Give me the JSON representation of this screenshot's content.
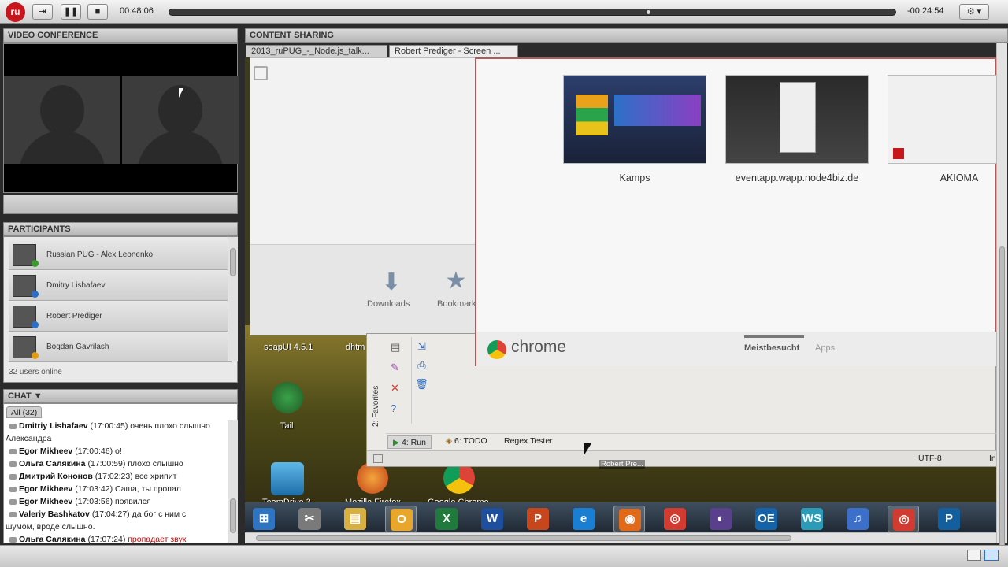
{
  "player": {
    "logo_text": "ru",
    "elapsed": "00:48:06",
    "remaining": "-00:24:54",
    "progress": 0.66,
    "gear_label": "⚙ ▾"
  },
  "video_panel": {
    "title": "VIDEO CONFERENCE"
  },
  "participants_panel": {
    "title": "PARTICIPANTS",
    "items": [
      {
        "name": "Russian PUG - Alex Leonenko",
        "status_color": "#3c9a2e"
      },
      {
        "name": "Dmitry Lishafaev",
        "status_color": "#2a6fc9"
      },
      {
        "name": "Robert Prediger",
        "status_color": "#2a6fc9"
      },
      {
        "name": "Bogdan Gavrilash",
        "status_color": "#e39b12"
      }
    ],
    "online_count": "32 users online"
  },
  "chat_panel": {
    "title": "CHAT ▼",
    "tab_all": "All (32)",
    "messages": [
      {
        "author": "Dmitriy Lishafaev",
        "time": "(17:00:45)",
        "text": "очень плохо слышно"
      },
      {
        "author": "",
        "time": "",
        "text": "Александра"
      },
      {
        "author": "Egor Mikheev",
        "time": "(17:00:46)",
        "text": "о!"
      },
      {
        "author": "Ольга Салякина",
        "time": "(17:00:59)",
        "text": "плохо слышно"
      },
      {
        "author": "Дмитрий Кононов",
        "time": "(17:02:23)",
        "text": "все хрипит"
      },
      {
        "author": "Egor Mikheev",
        "time": "(17:03:42)",
        "text": "Саша, ты пропал"
      },
      {
        "author": "Egor Mikheev",
        "time": "(17:03:56)",
        "text": "появился"
      },
      {
        "author": "Valeriy Bashkatov",
        "time": "(17:04:27)",
        "text": "да бог с ним с"
      },
      {
        "author": "",
        "time": "",
        "text": "шумом, вроде слышно."
      },
      {
        "author": "Ольга Салякина",
        "time": "(17:07:24)",
        "text": "пропадает звук"
      }
    ]
  },
  "content_panel": {
    "title": "CONTENT SHARING",
    "tabs": [
      {
        "label": "2013_ruPUG_-_Node.js_talk..."
      },
      {
        "label": "Robert Prediger - Screen ..."
      }
    ]
  },
  "shared_screen": {
    "chrome_left": {
      "downloads_label": "Downloads",
      "bookmarks_label": "Bookmarks"
    },
    "chrome_right": {
      "thumbnails": [
        {
          "label": "Kamps"
        },
        {
          "label": "eventapp.wapp.node4biz.de"
        },
        {
          "label": "AKIOMA"
        }
      ],
      "brand": "chrome",
      "tab_most_visited": "Meistbesucht",
      "tab_apps": "Apps"
    },
    "desktop_icons": [
      {
        "label": "soapUI 4.5.1"
      },
      {
        "label": "dhtm"
      },
      {
        "label": "Tail"
      },
      {
        "label": "TeamDrive 3"
      },
      {
        "label": "Mozilla Firefox"
      },
      {
        "label": "Google Chrome"
      }
    ],
    "ide": {
      "favorites_label": "2: Favorites",
      "run_label": "4: Run",
      "todo_label": "6: TODO",
      "regex_label": "Regex Tester",
      "encoding": "UTF-8",
      "insert": "In"
    },
    "cursor_label": "Robert Pre...",
    "taskbar_icons": [
      {
        "name": "windows-start",
        "glyph": "⊞",
        "color": "#2f74c0"
      },
      {
        "name": "snipping",
        "glyph": "✂",
        "color": "#7a7a7a"
      },
      {
        "name": "explorer",
        "glyph": "▤",
        "color": "#d8b041"
      },
      {
        "name": "outlook",
        "glyph": "O",
        "color": "#e8a72a"
      },
      {
        "name": "excel",
        "glyph": "X",
        "color": "#1f7a3b"
      },
      {
        "name": "word",
        "glyph": "W",
        "color": "#1d4f9e"
      },
      {
        "name": "powerpoint",
        "glyph": "P",
        "color": "#c8461b"
      },
      {
        "name": "ie",
        "glyph": "e",
        "color": "#1a7ed3"
      },
      {
        "name": "firefox",
        "glyph": "◉",
        "color": "#e06a1a"
      },
      {
        "name": "chrome",
        "glyph": "◎",
        "color": "#d23b2f"
      },
      {
        "name": "eclipse",
        "glyph": "◐",
        "color": "#5a3f8c"
      },
      {
        "name": "oe",
        "glyph": "OE",
        "color": "#1463a8"
      },
      {
        "name": "webstorm",
        "glyph": "WS",
        "color": "#2a9cb8"
      },
      {
        "name": "itunes",
        "glyph": "♫",
        "color": "#3b6fc9"
      },
      {
        "name": "chrome-active",
        "glyph": "◎",
        "color": "#d23b2f"
      },
      {
        "name": "p-app",
        "glyph": "P",
        "color": "#135e9c"
      }
    ]
  }
}
